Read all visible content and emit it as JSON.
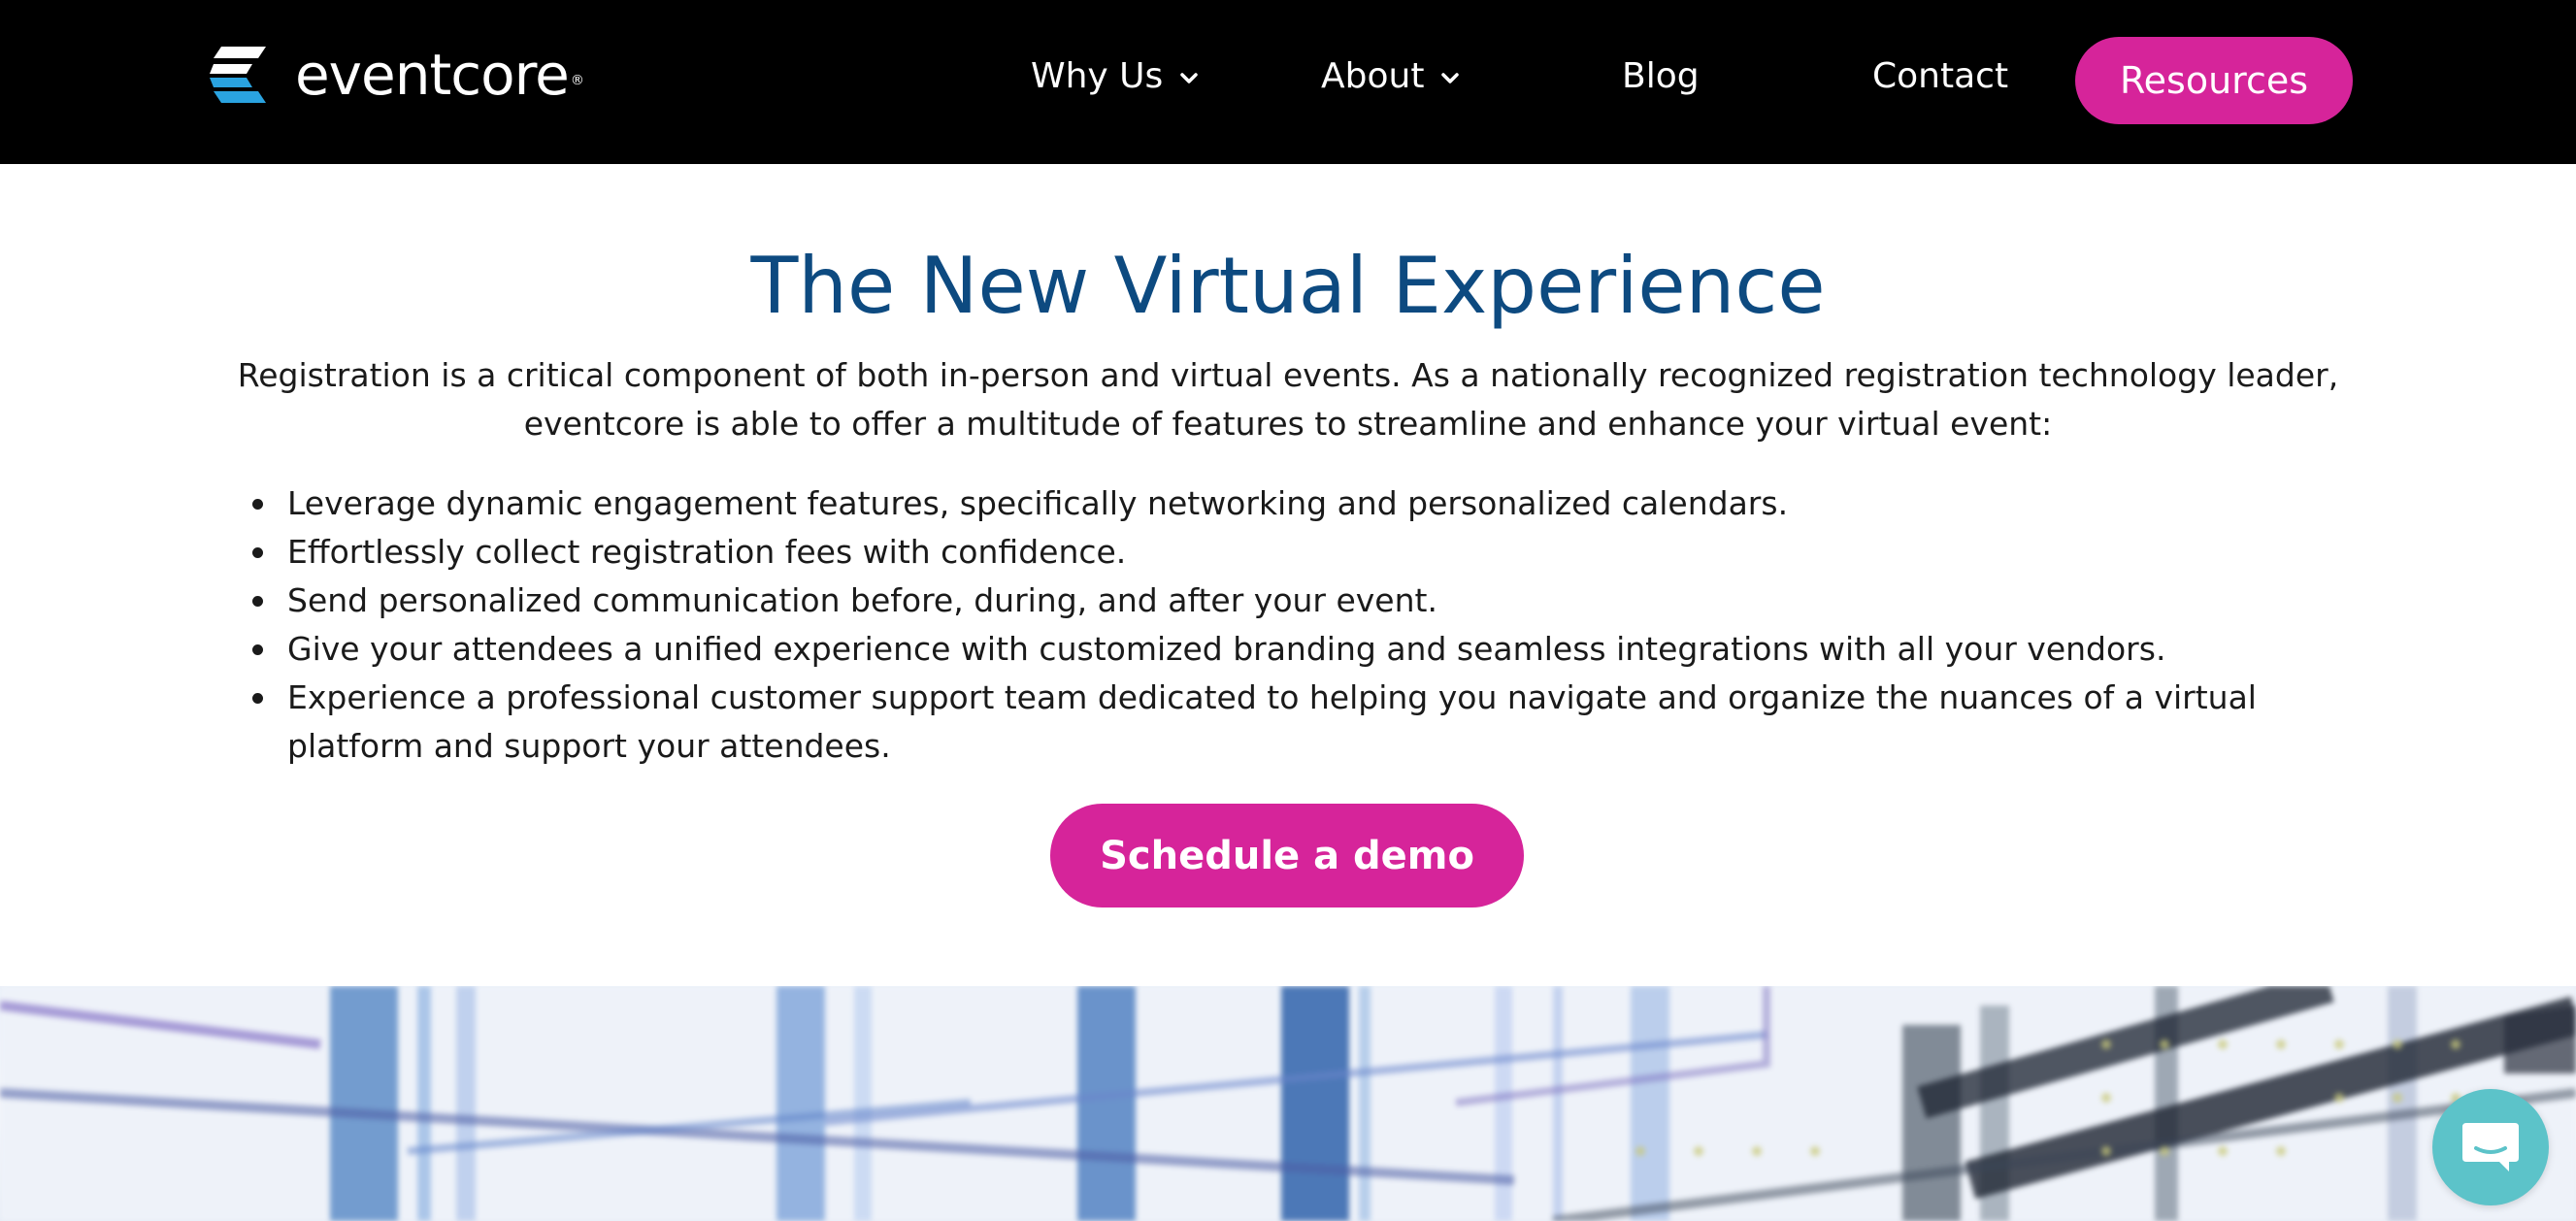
{
  "header": {
    "logo_text": "eventcore",
    "logo_mark": "®",
    "nav": [
      {
        "label": "Why Us",
        "icon": "chevron-down-icon"
      },
      {
        "label": "About",
        "icon": "chevron-down-icon"
      },
      {
        "label": "Blog"
      },
      {
        "label": "Contact"
      }
    ],
    "resources_label": "Resources"
  },
  "main": {
    "title": "The New Virtual Experience",
    "intro": "Registration is a critical component of both in-person and virtual events. As a nationally recognized registration technology leader, eventcore is able to offer a multitude of features to streamline and enhance your virtual event:",
    "bullets": [
      "Leverage dynamic engagement features, specifically networking and personalized calendars.",
      "Effortlessly collect registration fees with confidence.",
      "Send personalized communication before, during, and after your event.",
      "Give your attendees a unified experience with customized branding and seamless integrations with all your vendors.",
      "Experience a professional customer support team dedicated to helping you navigate and organize the nuances of a virtual platform and support your attendees."
    ],
    "cta_label": "Schedule a demo"
  },
  "chat": {
    "icon": "chat-bubble-icon"
  },
  "colors": {
    "accent": "#d6249a",
    "title": "#0d4a80",
    "header_bg": "#000000",
    "chat_bg": "#5cc3c9",
    "logo_blue": "#2aa3e0"
  }
}
